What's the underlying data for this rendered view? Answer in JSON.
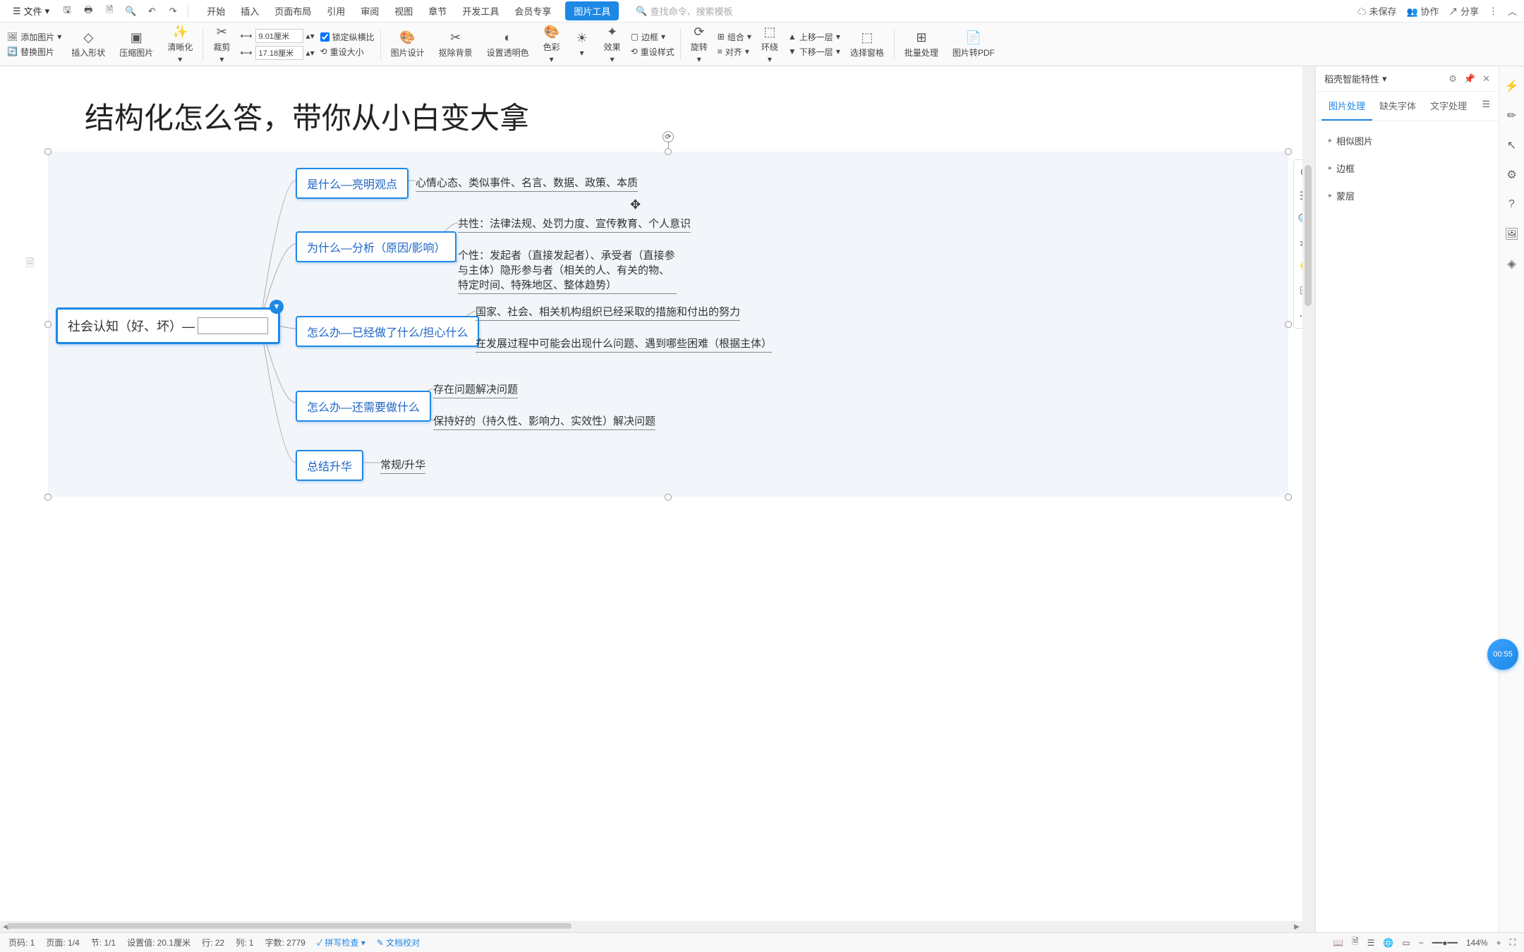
{
  "topbar": {
    "file": "文件",
    "tabs": [
      "开始",
      "插入",
      "页面布局",
      "引用",
      "审阅",
      "视图",
      "章节",
      "开发工具",
      "会员专享",
      "图片工具"
    ],
    "active_tab": 9,
    "search_placeholder": "查找命令、搜索模板",
    "unsaved": "未保存",
    "collab": "协作",
    "share": "分享"
  },
  "ribbon": {
    "add_image": "添加图片",
    "replace_image": "替换图片",
    "insert_shape": "插入形状",
    "compress": "压缩图片",
    "clarity": "清晰化",
    "crop": "裁剪",
    "width_val": "9.01厘米",
    "height_val": "17.18厘米",
    "lock_ratio": "锁定纵横比",
    "reset_size": "重设大小",
    "img_design": "图片设计",
    "remove_bg": "抠除背景",
    "transparency": "设置透明色",
    "color": "色彩",
    "effect": "效果",
    "border": "边框",
    "reset_style": "重设样式",
    "rotate": "旋转",
    "combine": "组合",
    "align": "对齐",
    "wrap": "环绕",
    "up_layer": "上移一层",
    "down_layer": "下移一层",
    "select_pane": "选择窗格",
    "batch": "批量处理",
    "to_pdf": "图片转PDF"
  },
  "document": {
    "title": "结构化怎么答，带你从小白变大拿",
    "root": "社会认知（好、坏）—",
    "branches": [
      {
        "label": "是什么—亮明观点",
        "leaves": [
          "心情心态、类似事件、名言、数据、政策、本质"
        ]
      },
      {
        "label": "为什么—分析（原因/影响）",
        "leaves": [
          "共性：法律法规、处罚力度、宣传教育、个人意识",
          "个性：发起者（直接发起者）、承受者（直接参与主体）隐形参与者（相关的人、有关的物、特定时间、特殊地区、整体趋势）"
        ]
      },
      {
        "label": "怎么办—已经做了什么/担心什么",
        "leaves": [
          "国家、社会、相关机构组织已经采取的措施和付出的努力",
          "在发展过程中可能会出现什么问题、遇到哪些困难（根据主体）"
        ]
      },
      {
        "label": "怎么办—还需要做什么",
        "leaves": [
          "存在问题解决问题",
          "保持好的（持久性、影响力、实效性）解决问题"
        ]
      },
      {
        "label": "总结升华",
        "leaves": [
          "常规/升华"
        ]
      }
    ]
  },
  "right_panel": {
    "title": "稻壳智能特性",
    "tabs": [
      "图片处理",
      "缺失字体",
      "文字处理"
    ],
    "active": 0,
    "items": [
      "相似图片",
      "边框",
      "蒙层"
    ]
  },
  "timer": "00:55",
  "status": {
    "page_num": "页码: 1",
    "page": "页面: 1/4",
    "section": "节: 1/1",
    "setval": "设置值: 20.1厘米",
    "row": "行: 22",
    "col": "列: 1",
    "words": "字数: 2779",
    "spell": "拼写检查",
    "proof": "文档校对",
    "zoom": "144%"
  }
}
